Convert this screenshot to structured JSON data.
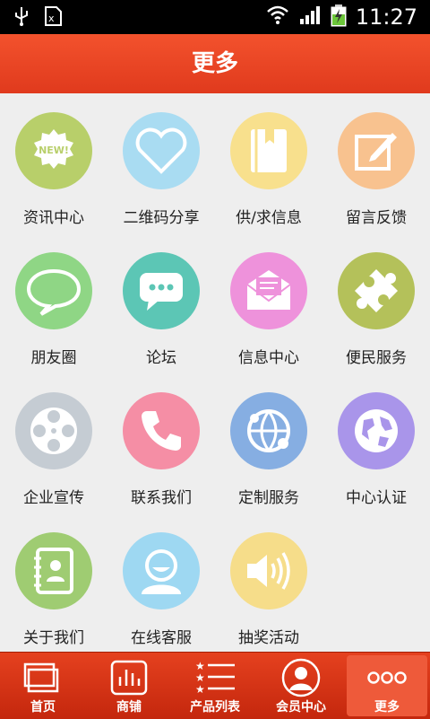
{
  "status": {
    "time": "11:27"
  },
  "header": {
    "title": "更多"
  },
  "grid": [
    {
      "label": "资讯中心",
      "color": "#b8cf6a",
      "icon": "news-badge-icon",
      "badge": "NEW!"
    },
    {
      "label": "二维码分享",
      "color": "#a9dcf2",
      "icon": "heart-icon"
    },
    {
      "label": "供/求信息",
      "color": "#f8e08d",
      "icon": "book-icon"
    },
    {
      "label": "留言反馈",
      "color": "#f8c28f",
      "icon": "edit-note-icon"
    },
    {
      "label": "朋友圈",
      "color": "#8fd685",
      "icon": "speech-bubble-icon"
    },
    {
      "label": "论坛",
      "color": "#5cc6b5",
      "icon": "chat-icon"
    },
    {
      "label": "信息中心",
      "color": "#ee92db",
      "icon": "envelope-icon"
    },
    {
      "label": "便民服务",
      "color": "#b4c15a",
      "icon": "puzzle-icon"
    },
    {
      "label": "企业宣传",
      "color": "#c5ccd3",
      "icon": "film-reel-icon"
    },
    {
      "label": "联系我们",
      "color": "#f58ea5",
      "icon": "phone-icon"
    },
    {
      "label": "定制服务",
      "color": "#86aee2",
      "icon": "network-globe-icon"
    },
    {
      "label": "中心认证",
      "color": "#a995ea",
      "icon": "globe-icon"
    },
    {
      "label": "关于我们",
      "color": "#9fcc72",
      "icon": "contact-book-icon"
    },
    {
      "label": "在线客服",
      "color": "#9ed8f2",
      "icon": "user-icon"
    },
    {
      "label": "抽奖活动",
      "color": "#f6dd8a",
      "icon": "speaker-icon"
    }
  ],
  "tabs": [
    {
      "label": "首页",
      "icon": "home-window-icon"
    },
    {
      "label": "商铺",
      "icon": "bar-chart-icon"
    },
    {
      "label": "产品列表",
      "icon": "star-list-icon"
    },
    {
      "label": "会员中心",
      "icon": "member-icon"
    },
    {
      "label": "更多",
      "icon": "more-dots-icon",
      "active": true
    }
  ]
}
